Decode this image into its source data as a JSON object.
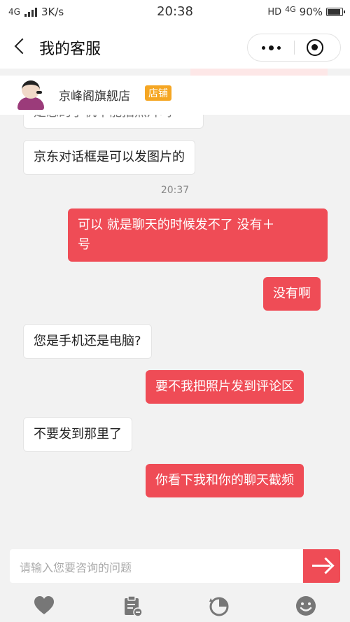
{
  "status": {
    "network": "4G",
    "speed": "3K/s",
    "time": "20:38",
    "hd": "HD",
    "net_right": "4G",
    "battery": "90%"
  },
  "nav": {
    "title": "我的客服",
    "back_icon": "chevron-left-icon",
    "more_icon": "more-dots-icon",
    "close_icon": "target-close-icon"
  },
  "shop": {
    "name": "京峰阁旗舰店",
    "badge": "店铺"
  },
  "messages": [
    {
      "side": "left",
      "text": "是您的手机不能拍照片吗"
    },
    {
      "side": "left",
      "text": "京东对话框是可以发图片的"
    },
    {
      "side": "time",
      "text": "20:37"
    },
    {
      "side": "right",
      "line1": "可以 就是聊天的时候发不了 没有＋",
      "line2": "号"
    },
    {
      "side": "right",
      "text": "没有啊"
    },
    {
      "side": "left",
      "text": "您是手机还是电脑?"
    },
    {
      "side": "right",
      "text": "要不我把照片发到评论区"
    },
    {
      "side": "left",
      "text": "不要发到那里了"
    },
    {
      "side": "right",
      "text": "你看下我和你的聊天截频"
    }
  ],
  "input": {
    "placeholder": "请输入您要咨询的问题",
    "send_icon": "arrow-right-icon"
  },
  "toolbar": {
    "icons": [
      "heart-icon",
      "clipboard-icon",
      "history-icon",
      "emoji-icon"
    ]
  },
  "colors": {
    "accent": "#ef4c56",
    "badge": "#f5a623"
  }
}
